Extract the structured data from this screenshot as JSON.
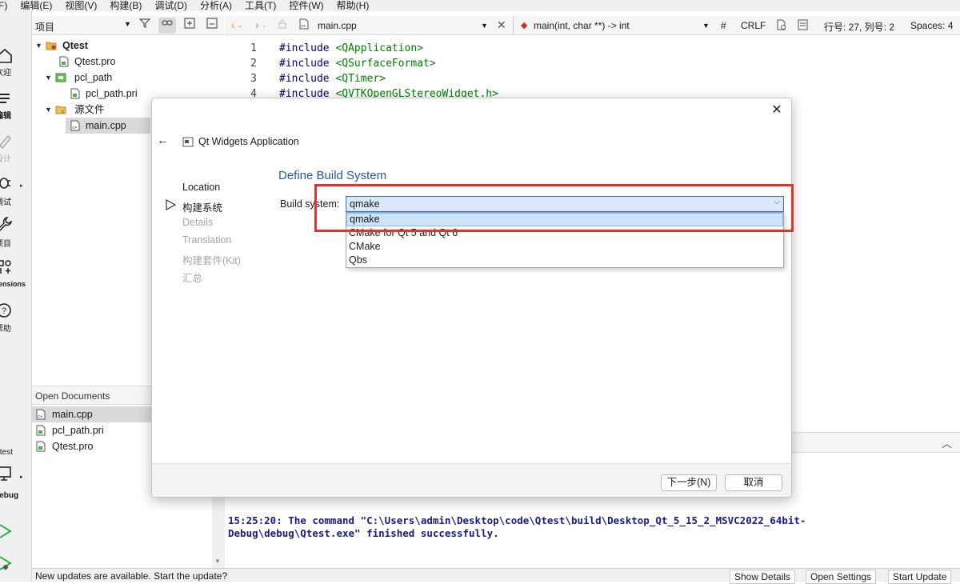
{
  "menubar": {
    "items": [
      "(F)",
      "编辑(E)",
      "视图(V)",
      "构建(B)",
      "调试(D)",
      "分析(A)",
      "工具(T)",
      "控件(W)",
      "帮助(H)"
    ]
  },
  "modebar": {
    "welcome": "欢迎",
    "edit": "编辑",
    "design": "设计",
    "debug": "调试",
    "projects": "项目",
    "extensions": "Extensions",
    "help": "帮助",
    "target_project": "Qtest",
    "target_config": "Debug"
  },
  "project_panel": {
    "title": "项目",
    "tree": [
      {
        "label": "Qtest",
        "bold": true
      },
      {
        "label": "Qtest.pro"
      },
      {
        "label": "pcl_path"
      },
      {
        "label": "pcl_path.pri"
      },
      {
        "label": "源文件"
      },
      {
        "label": "main.cpp"
      }
    ]
  },
  "open_documents": {
    "title": "Open Documents",
    "items": [
      "main.cpp",
      "pcl_path.pri",
      "Qtest.pro"
    ]
  },
  "editor": {
    "file_name": "main.cpp",
    "function_scope": "main(int, char **) -> int",
    "hash": "#",
    "line_ending": "CRLF",
    "cursor_position": "行号: 27, 列号: 2",
    "indentation": "Spaces: 4",
    "lines": [
      {
        "num": "1",
        "kw": "#include",
        "inc": "<QApplication>"
      },
      {
        "num": "2",
        "kw": "#include",
        "inc": "<QSurfaceFormat>"
      },
      {
        "num": "3",
        "kw": "#include",
        "inc": "<QTimer>"
      },
      {
        "num": "4",
        "kw": "#include",
        "inc": "<QVTKOpenGLStereoWidget.h>"
      }
    ]
  },
  "output": {
    "message": "15:25:20: The command \"C:\\Users\\admin\\Desktop\\code\\Qtest\\build\\Desktop_Qt_5_15_2_MSVC2022_64bit-\nDebug\\debug\\Qtest.exe\" finished successfully."
  },
  "statusbar": {
    "text": "New updates are available. Start the update?",
    "show_details": "Show Details",
    "open_settings": "Open Settings",
    "start_update": "Start Update"
  },
  "dialog": {
    "title": "Qt Widgets Application",
    "steps": [
      {
        "label": "Location",
        "state": "done"
      },
      {
        "label": "构建系统",
        "state": "current"
      },
      {
        "label": "Details",
        "state": "pending"
      },
      {
        "label": "Translation",
        "state": "pending"
      },
      {
        "label": "构建套件(Kit)",
        "state": "pending"
      },
      {
        "label": "汇总",
        "state": "pending"
      }
    ],
    "section_title": "Define Build System",
    "build_system_label": "Build system:",
    "selected_value": "qmake",
    "options": [
      "qmake",
      "CMake for Qt 5 and Qt 6",
      "CMake",
      "Qbs"
    ],
    "next_button": "下一步(N)",
    "cancel_button": "取消"
  },
  "colors": {
    "accent_blue": "#2457a8",
    "highlight_red": "#e5322d",
    "selection_blue": "#cce4f7",
    "string_green": "#008000"
  }
}
